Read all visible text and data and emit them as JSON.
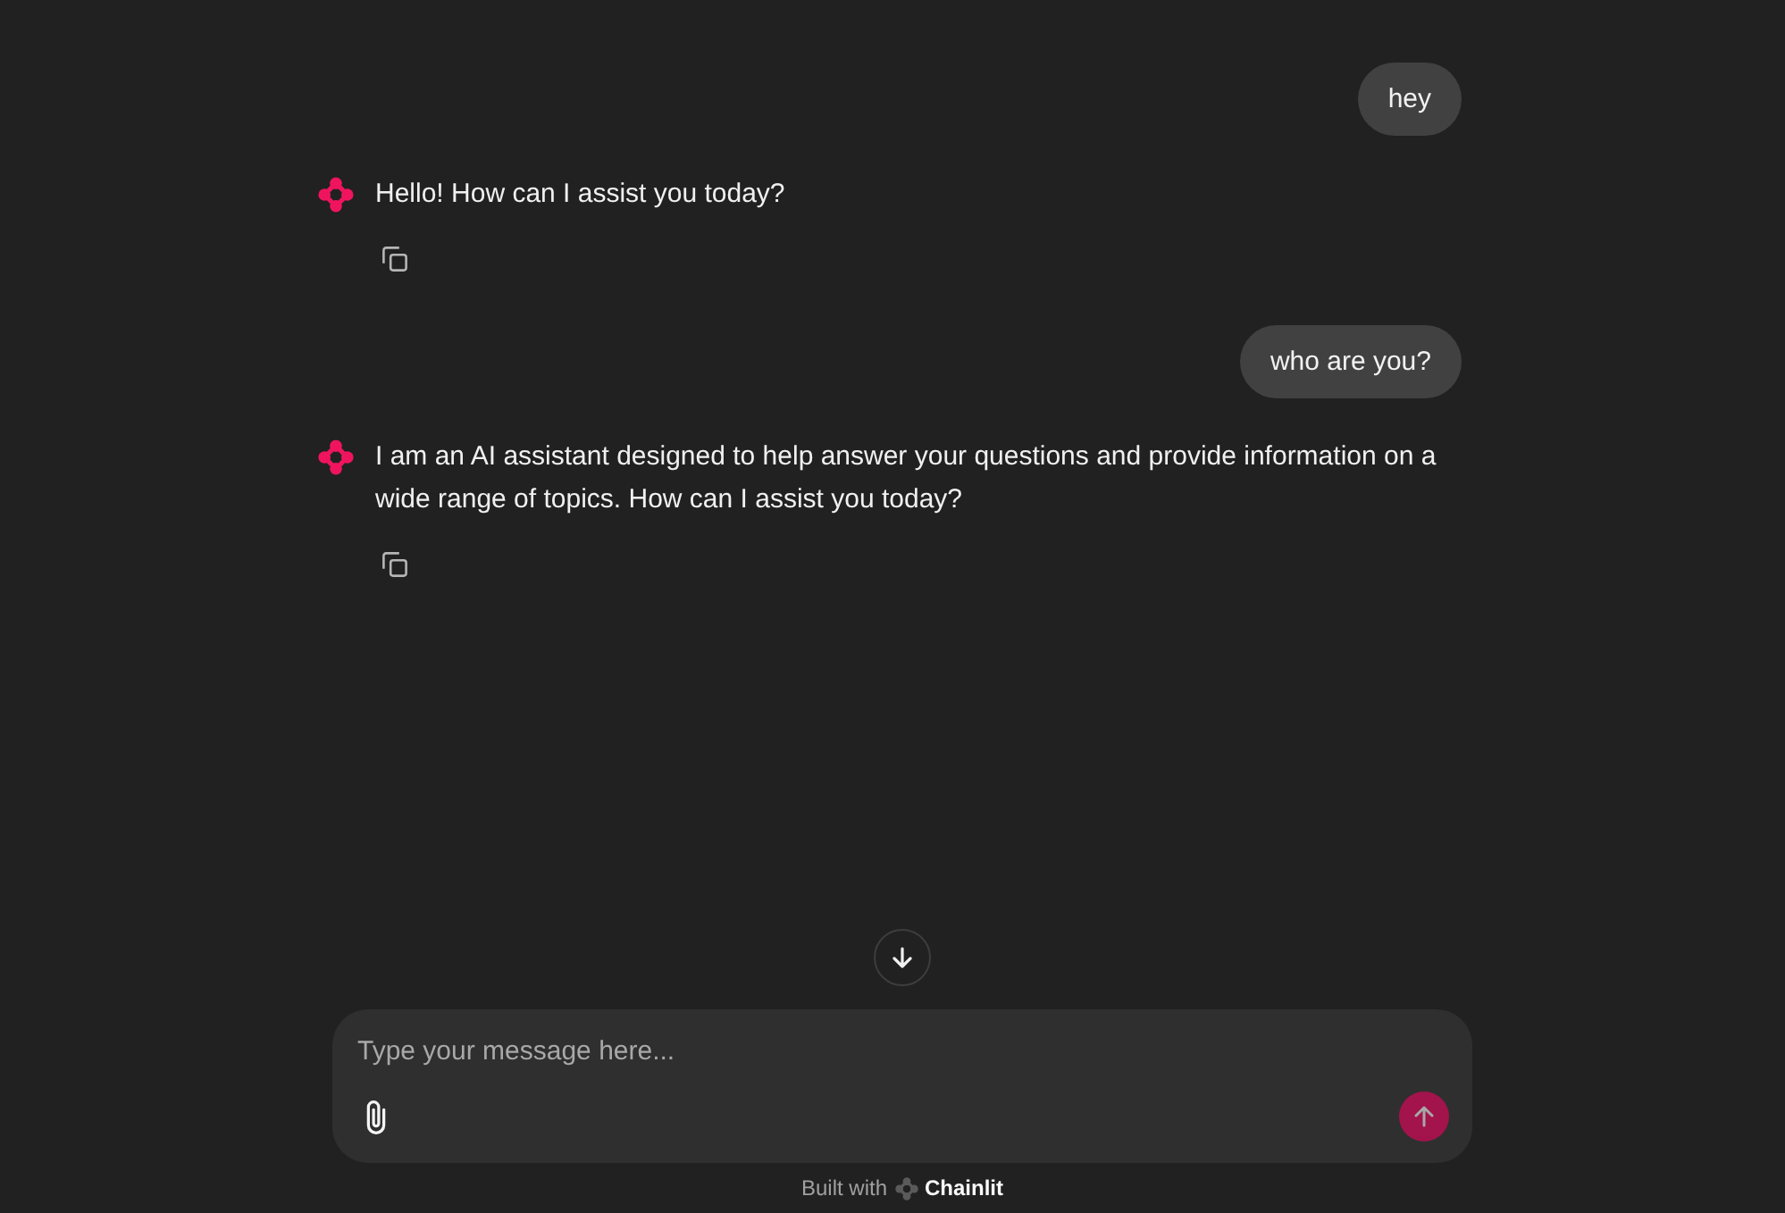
{
  "messages": [
    {
      "kind": "user",
      "text": "hey"
    },
    {
      "kind": "assistant",
      "text": "Hello! How can I assist you today?"
    },
    {
      "kind": "user",
      "text": "who are you?"
    },
    {
      "kind": "assistant",
      "text": "I am an AI assistant designed to help answer your questions and provide information on a wide range of topics. How can I assist you today?"
    }
  ],
  "composer": {
    "placeholder": "Type your message here...",
    "send_button": {
      "disabled": true
    }
  },
  "footer": {
    "prefix": "Built with",
    "brand": "Chainlit"
  }
}
